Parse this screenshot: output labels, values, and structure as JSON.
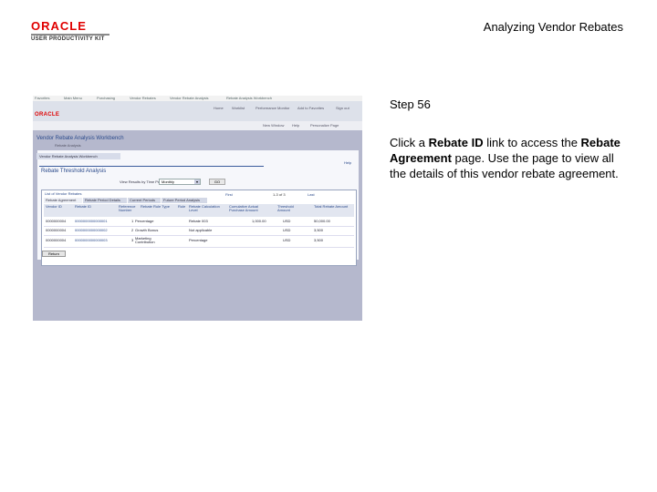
{
  "header": {
    "logo": "ORACLE",
    "logo_sub": "USER PRODUCTIVITY KIT",
    "title": "Analyzing Vendor Rebates"
  },
  "instructions": {
    "step": "Step 56",
    "text_1": "Click a ",
    "bold_1": "Rebate ID",
    "text_2": " link to access the ",
    "bold_2": "Rebate Agreement",
    "text_3": " page. Use the page to view all the details of this vendor rebate agreement."
  },
  "screenshot": {
    "topbar": [
      "Favorites",
      "Main Menu",
      "Purchasing",
      "Vendor Rebates",
      "Vendor Rebate Analysis",
      "Rebate Analysis Workbench"
    ],
    "navlinks": [
      "Home",
      "Worklist",
      "Performance Monitor",
      "Add to Favorites",
      "Sign out"
    ],
    "oracle": "ORACLE",
    "subbar": [
      "New Window",
      "Help",
      "Personalize Page"
    ],
    "workbench_title": "Vendor Rebate Analysis Workbench",
    "workbench_sub": "Rebate Analysis",
    "tab": "Vendor Rebate Analysis Workbench",
    "help": "Help",
    "section_title": "Rebate Threshold Analysis",
    "view_label": "View Results by Time Period:",
    "period": "Monthly",
    "go": "GO",
    "grid_title": "List of Vendor Rebates",
    "nav_first": "First",
    "nav_count": "1-3 of 3",
    "nav_last": "Last",
    "grid_tabs": [
      "Rebate Agreement",
      "Rebate Period Details",
      "Current Periods",
      "Future Period Analysis"
    ],
    "headers": [
      "Vendor ID",
      "Rebate ID",
      "Reference Number",
      "Rebate Rule Type",
      "Rule",
      "Rebate Calculation Level",
      "Cumulative Actual Purchase Amount",
      "Threshold Amount",
      "Total Rebate Amount"
    ],
    "rows": [
      [
        "0000000004",
        "0000000000000001",
        "1",
        "Percentage",
        "",
        "Rebate 003",
        "1,000.00",
        "USD",
        "50,000.00"
      ],
      [
        "0000000004",
        "0000000000000002",
        "2",
        "Growth Bonus",
        "",
        "Not applicable",
        "",
        "USD",
        "3,500"
      ],
      [
        "0000000004",
        "0000000000000003",
        "3",
        "Marketing Contribution",
        "",
        "Percentage",
        "",
        "USD",
        "3,500"
      ]
    ],
    "return_button": "Return"
  }
}
